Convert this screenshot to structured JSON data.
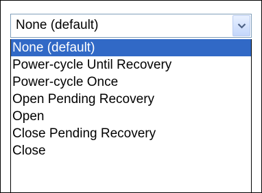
{
  "select": {
    "value": "None (default)",
    "arrow_icon": "chevron-down-icon"
  },
  "options": [
    {
      "label": "None (default)",
      "selected": true
    },
    {
      "label": "Power-cycle Until Recovery",
      "selected": false
    },
    {
      "label": "Power-cycle Once",
      "selected": false
    },
    {
      "label": "Open Pending Recovery",
      "selected": false
    },
    {
      "label": "Open",
      "selected": false
    },
    {
      "label": "Close Pending Recovery",
      "selected": false
    },
    {
      "label": "Close",
      "selected": false
    }
  ],
  "colors": {
    "highlight": "#3169c6",
    "highlight_text": "#ffffff",
    "border": "#7f9db9"
  }
}
